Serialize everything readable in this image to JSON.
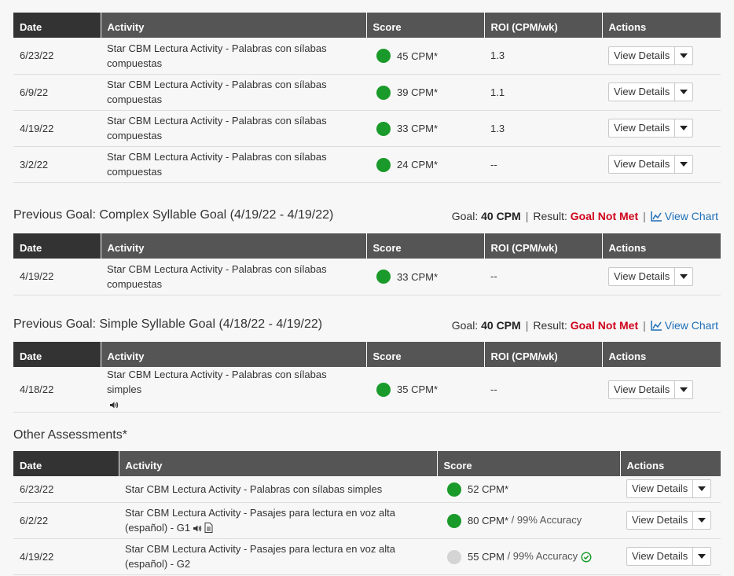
{
  "headers": {
    "date": "Date",
    "activity": "Activity",
    "score": "Score",
    "roi": "ROI (CPM/wk)",
    "actions": "Actions"
  },
  "view_details_label": "View Details",
  "colors": {
    "green_dot": "#1a9a2a",
    "grey_dot": "#d4d4d4",
    "not_met": "#d0021b",
    "link": "#1e6fb8"
  },
  "current_goal": {
    "rows": [
      {
        "date": "6/23/22",
        "activity": "Star CBM Lectura Activity - Palabras con sílabas compuestas",
        "score": "45 CPM*",
        "roi": "1.3"
      },
      {
        "date": "6/9/22",
        "activity": "Star CBM Lectura Activity - Palabras con sílabas compuestas",
        "score": "39 CPM*",
        "roi": "1.1"
      },
      {
        "date": "4/19/22",
        "activity": "Star CBM Lectura Activity - Palabras con sílabas compuestas",
        "score": "33 CPM*",
        "roi": "1.3"
      },
      {
        "date": "3/2/22",
        "activity": "Star CBM Lectura Activity - Palabras con sílabas compuestas",
        "score": "24 CPM*",
        "roi": "--"
      }
    ]
  },
  "prev_goal_1": {
    "title": "Previous Goal: Complex Syllable Goal (4/19/22 - 4/19/22)",
    "goal_label": "Goal:",
    "goal_value": "40 CPM",
    "result_label": "Result:",
    "result_value": "Goal Not Met",
    "view_chart": "View Chart",
    "rows": [
      {
        "date": "4/19/22",
        "activity": "Star CBM Lectura Activity - Palabras con sílabas compuestas",
        "score": "33 CPM*",
        "roi": "--"
      }
    ]
  },
  "prev_goal_2": {
    "title": "Previous Goal: Simple Syllable Goal (4/18/22 - 4/19/22)",
    "goal_label": "Goal:",
    "goal_value": "40 CPM",
    "result_label": "Result:",
    "result_value": "Goal Not Met",
    "view_chart": "View Chart",
    "rows": [
      {
        "date": "4/18/22",
        "activity": "Star CBM Lectura Activity - Palabras con sílabas simples",
        "score": "35 CPM*",
        "roi": "--"
      }
    ]
  },
  "other": {
    "title": "Other Assessments*",
    "rows": [
      {
        "date": "6/23/22",
        "activity": "Star CBM Lectura Activity - Palabras con sílabas simples",
        "score": "52 CPM*",
        "accuracy": ""
      },
      {
        "date": "6/2/22",
        "activity": "Star CBM Lectura Activity - Pasajes para lectura en voz alta (español) - G1",
        "score": "80 CPM*",
        "accuracy": " / 99% Accuracy"
      },
      {
        "date": "4/19/22",
        "activity": "Star CBM Lectura Activity - Pasajes para lectura en voz alta (español) - G2",
        "score": "55 CPM",
        "accuracy": " / 99% Accuracy"
      }
    ]
  }
}
